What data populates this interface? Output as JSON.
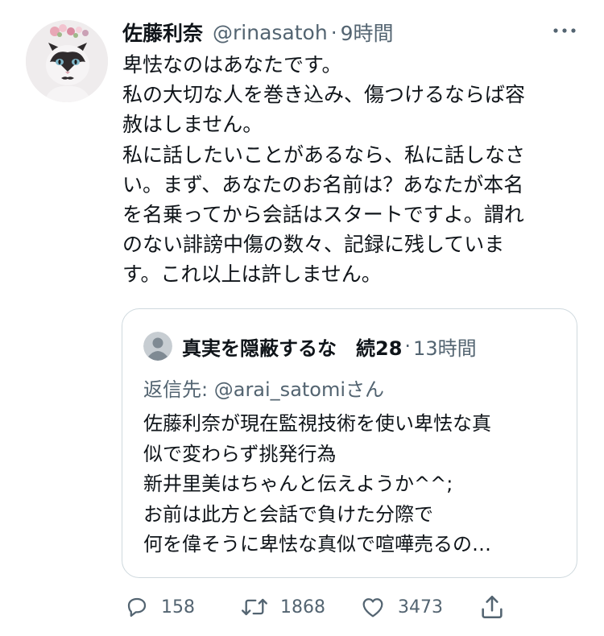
{
  "tweet": {
    "author_name": "佐藤利奈",
    "handle": "@rinasatoh",
    "separator": "·",
    "time": "9時間",
    "more_icon": "ellipsis-icon",
    "text_lines": [
      "卑怯なのはあなたです。",
      "私の大切な人を巻き込み、傷つけるならば容",
      "赦はしません。",
      "私に話したいことがあるなら、私に話しなさ",
      "い。まず、あなたのお名前は？あなたが本名",
      "を名乗ってから会話はスタートですよ。謂れ",
      "のない誹謗中傷の数々、記録に残していま",
      "す。これ以上は許しません。"
    ]
  },
  "quoted": {
    "author_name": "真実を隠蔽するな　続28",
    "separator": "·",
    "time": "13時間",
    "reply_prefix": "返信先:",
    "reply_to": "@arai_satomiさん",
    "text_lines": [
      "佐藤利奈が現在監視技術を使い卑怯な真",
      "似で変わらず挑発行為",
      "新井里美はちゃんと伝えようか^^;",
      "お前は此方と会話で負けた分際で",
      "何を偉そうに卑怯な真似で喧嘩売るの…"
    ]
  },
  "actions": {
    "reply": {
      "icon": "reply-icon",
      "count": "158"
    },
    "retweet": {
      "icon": "retweet-icon",
      "count": "1868"
    },
    "like": {
      "icon": "heart-icon",
      "count": "3473"
    },
    "share": {
      "icon": "share-icon"
    }
  },
  "colors": {
    "text": "#0f1419",
    "secondary": "#536471",
    "border": "#cfd9de",
    "icon": "#536471"
  }
}
